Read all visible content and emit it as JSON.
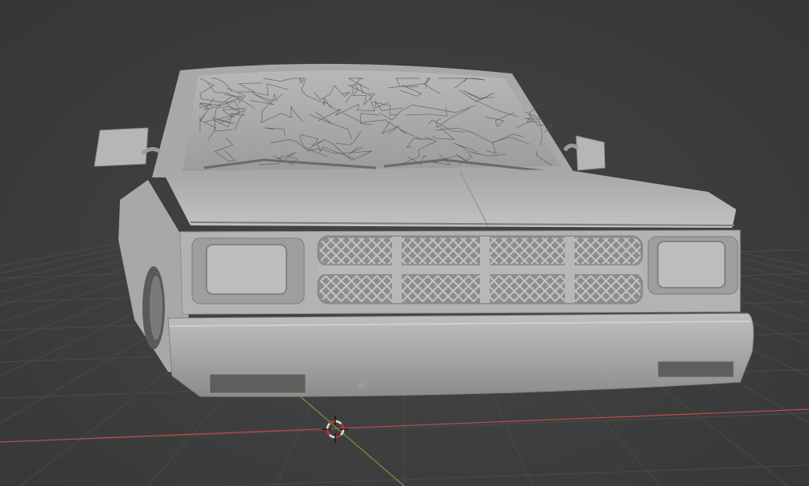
{
  "viewport": {
    "mode": "3d-viewport",
    "shading": "solid",
    "background_color": "#3d3d3d",
    "grid_color": "#4a4a4a",
    "x_axis_color": "#c04a4a",
    "y_axis_color": "#6f9a3a"
  },
  "model": {
    "subject": "pickup-truck-front",
    "material_color": "#a8a8a6"
  },
  "cursor": {
    "icon": "3d-cursor-icon",
    "ring_color_a": "#e0e0e0",
    "ring_color_b": "#d03030"
  }
}
